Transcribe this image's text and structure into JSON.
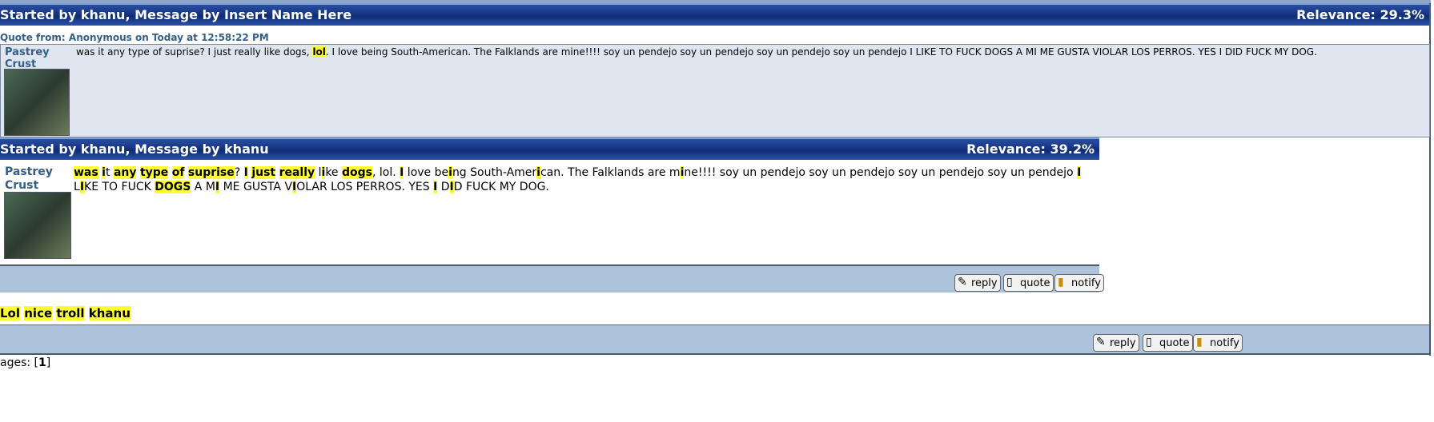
{
  "result1": {
    "header_left": "Started by khanu, Message by Insert Name Here",
    "relevance": "Relevance: 29.3%",
    "quote_from": "Quote from: Anonymous on Today at 12:58:22 PM",
    "author": "Pastrey Crust",
    "message_pre": "was it any type of suprise? I just really like dogs, ",
    "message_hl": "lol",
    "message_post": ". I love being South-American. The Falklands are mine!!!! soy un pendejo soy un pendejo soy un pendejo soy un pendejo I LIKE TO FUCK DOGS A MI ME GUSTA VIOLAR LOS PERROS. YES I DID FUCK MY DOG."
  },
  "result2": {
    "header_left": "Started by khanu, Message by khanu",
    "relevance": "Relevance: 39.2%",
    "author": "Pastrey Crust",
    "message_segments": [
      {
        "t": "was",
        "h": true
      },
      {
        "t": " ",
        "h": false
      },
      {
        "t": "i",
        "h": true
      },
      {
        "t": "t ",
        "h": false
      },
      {
        "t": "any",
        "h": true
      },
      {
        "t": " ",
        "h": false
      },
      {
        "t": "type",
        "h": true
      },
      {
        "t": " ",
        "h": false
      },
      {
        "t": "of",
        "h": true
      },
      {
        "t": " ",
        "h": false
      },
      {
        "t": "suprise",
        "h": true
      },
      {
        "t": "? ",
        "h": false
      },
      {
        "t": "I",
        "h": true
      },
      {
        "t": " ",
        "h": false
      },
      {
        "t": "just",
        "h": true
      },
      {
        "t": " ",
        "h": false
      },
      {
        "t": "really",
        "h": true
      },
      {
        "t": " l",
        "h": false
      },
      {
        "t": "i",
        "h": true
      },
      {
        "t": "ke ",
        "h": false
      },
      {
        "t": "dogs",
        "h": true
      },
      {
        "t": ", lol. ",
        "h": false
      },
      {
        "t": "I",
        "h": true
      },
      {
        "t": " love be",
        "h": false
      },
      {
        "t": "i",
        "h": true
      },
      {
        "t": "ng South-Amer",
        "h": false
      },
      {
        "t": "i",
        "h": true
      },
      {
        "t": "can. The Falklands are m",
        "h": false
      },
      {
        "t": "i",
        "h": true
      },
      {
        "t": "ne!!!! soy un pendejo soy un pendejo soy un pendejo soy un pendejo ",
        "h": false
      },
      {
        "t": "I",
        "h": true
      },
      {
        "t": " L",
        "h": false
      },
      {
        "t": "I",
        "h": true
      },
      {
        "t": "KE TO FUCK ",
        "h": false
      },
      {
        "t": "DOGS",
        "h": true
      },
      {
        "t": " A M",
        "h": false
      },
      {
        "t": "I",
        "h": true
      },
      {
        "t": " ME GUSTA V",
        "h": false
      },
      {
        "t": "I",
        "h": true
      },
      {
        "t": "OLAR LOS PERROS. YES ",
        "h": false
      },
      {
        "t": "I",
        "h": true
      },
      {
        "t": " D",
        "h": false
      },
      {
        "t": "I",
        "h": true
      },
      {
        "t": "D FUCK MY DOG.",
        "h": false
      }
    ],
    "actions": [
      "reply",
      "quote",
      "notify"
    ]
  },
  "reply_text": {
    "segments": [
      {
        "t": "Lol",
        "h": true
      },
      {
        "t": " ",
        "h": false
      },
      {
        "t": "nice",
        "h": true
      },
      {
        "t": " ",
        "h": false
      },
      {
        "t": "troll",
        "h": true
      },
      {
        "t": " ",
        "h": false
      },
      {
        "t": "khanu",
        "h": true
      }
    ]
  },
  "bottom_actions": [
    "reply",
    "quote",
    "notify"
  ],
  "pages": {
    "label": "ages: [",
    "current": "1",
    "close": "]"
  },
  "icons": {
    "reply": "reply-icon",
    "quote": "quote-icon",
    "notify": "notify-icon"
  },
  "colors": {
    "highlight": "#ffff33",
    "header_bar": "#1a3a8a",
    "action_bar": "#adc2db",
    "quote_panel": "#dfe6f0",
    "author": "#335f8a"
  }
}
